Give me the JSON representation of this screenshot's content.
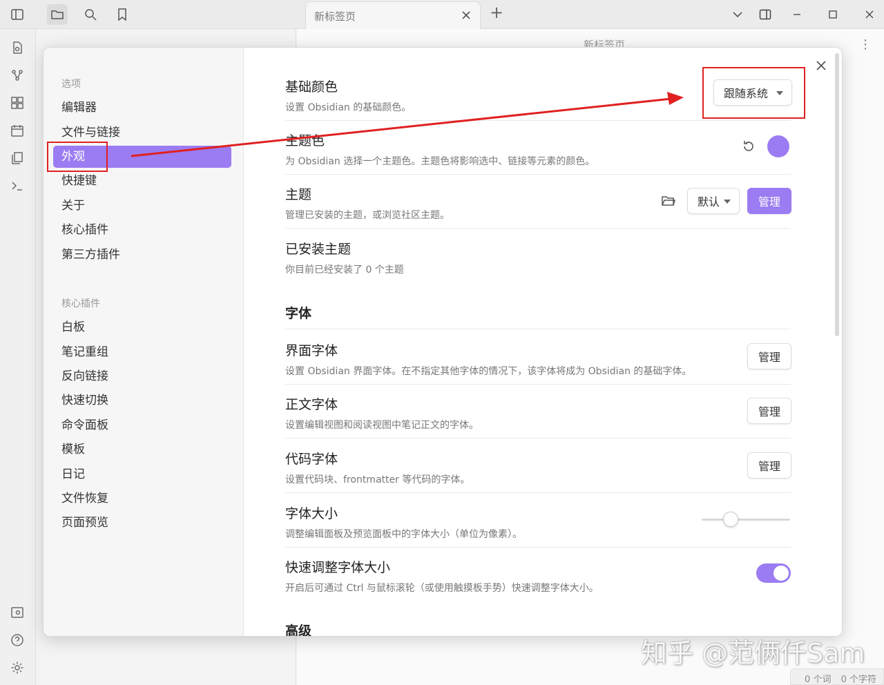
{
  "topbar": {
    "tab_title": "新标签页",
    "new_tab": "+"
  },
  "background": {
    "pane_title": "新标签页",
    "more": "⋮",
    "status_words": "0 个词",
    "status_chars": "0 个字符"
  },
  "sidebar": {
    "group_options": "选项",
    "options": [
      "编辑器",
      "文件与链接",
      "外观",
      "快捷键",
      "关于",
      "核心插件",
      "第三方插件"
    ],
    "active_index": 2,
    "group_core": "核心插件",
    "core_plugins": [
      "白板",
      "笔记重组",
      "反向链接",
      "快速切换",
      "命令面板",
      "模板",
      "日记",
      "文件恢复",
      "页面预览"
    ]
  },
  "settings": {
    "base_color": {
      "name": "基础颜色",
      "desc": "设置 Obsidian 的基础颜色。",
      "value": "跟随系统"
    },
    "accent_color": {
      "name": "主题色",
      "desc": "为 Obsidian 选择一个主题色。主题色将影响选中、链接等元素的颜色。",
      "color": "#9b7cf2"
    },
    "theme": {
      "name": "主题",
      "desc": "管理已安装的主题，或浏览社区主题。",
      "value": "默认",
      "manage": "管理"
    },
    "installed_themes": {
      "name": "已安装主题",
      "desc": "你目前已经安装了 0 个主题"
    },
    "font_heading": "字体",
    "interface_font": {
      "name": "界面字体",
      "desc": "设置 Obsidian 界面字体。在不指定其他字体的情况下，该字体将成为 Obsidian 的基础字体。",
      "manage": "管理"
    },
    "text_font": {
      "name": "正文字体",
      "desc": "设置编辑视图和阅读视图中笔记正文的字体。",
      "manage": "管理"
    },
    "mono_font": {
      "name": "代码字体",
      "desc": "设置代码块、frontmatter 等代码的字体。",
      "manage": "管理"
    },
    "font_size": {
      "name": "字体大小",
      "desc": "调整编辑面板及预览面板中的字体大小（单位为像素）。",
      "slider_fraction": 0.33
    },
    "quick_font": {
      "name": "快速调整字体大小",
      "desc": "开启后可通过 Ctrl 与鼠标滚轮（或使用触摸板手势）快速调整字体大小。",
      "enabled": true
    },
    "advanced_heading": "高级"
  },
  "watermark": "知乎 @范俩仟Sam",
  "colors": {
    "accent": "#9b7cf2",
    "annotation": "#e02020"
  }
}
